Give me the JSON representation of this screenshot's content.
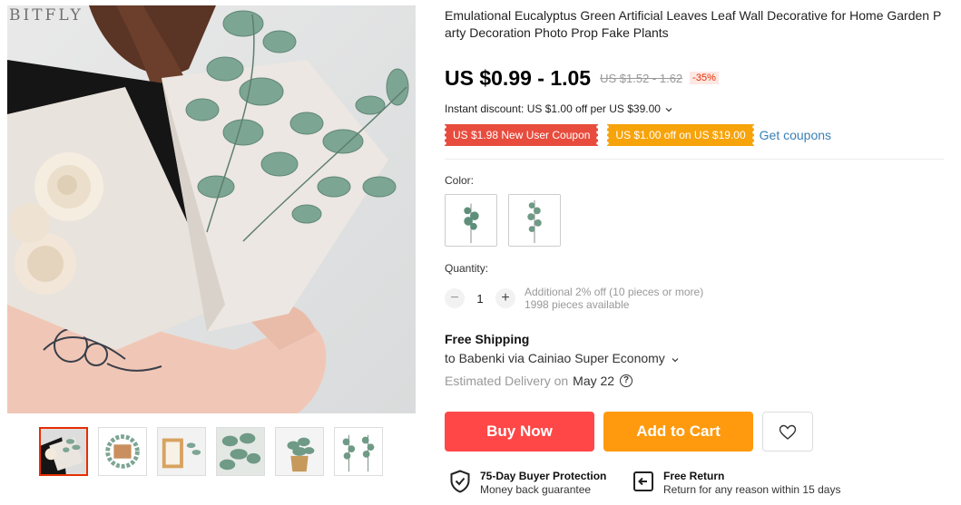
{
  "gallery": {
    "brand_watermark": "BITFLY",
    "thumbnails": [
      "eucalyptus bouquet",
      "wreath",
      "frame",
      "leaves",
      "potted",
      "branches"
    ]
  },
  "product": {
    "title": "Emulational Eucalyptus Green Artificial Leaves Leaf Wall Decorative for Home Garden Party Decoration Photo Prop Fake Plants",
    "price": "US $0.99 - 1.05",
    "original_price": "US $1.52 - 1.62",
    "discount": "-35%"
  },
  "promotions": {
    "instant_discount": "Instant discount: US $1.00 off per US $39.00",
    "coupon_new_user": "US $1.98 New User Coupon",
    "coupon_store": "US $1.00 off on US $19.00",
    "get_coupons": "Get coupons"
  },
  "sku": {
    "color_label": "Color:",
    "quantity_label": "Quantity:",
    "quantity_value": "1",
    "quantity_minus": "−",
    "quantity_plus": "+",
    "bulk_note": "Additional 2% off (10 pieces or more)",
    "available": "1998 pieces available"
  },
  "shipping": {
    "title": "Free Shipping",
    "route": "to Babenki via Cainiao Super Economy",
    "estimated_label": "Estimated Delivery on",
    "estimated_date": "May 22",
    "help": "?"
  },
  "actions": {
    "buy_now": "Buy Now",
    "add_to_cart": "Add to Cart"
  },
  "guarantees": [
    {
      "title": "75-Day Buyer Protection",
      "subtitle": "Money back guarantee"
    },
    {
      "title": "Free Return",
      "subtitle": "Return for any reason within 15 days"
    }
  ],
  "colors": {
    "price_red": "#ff4747",
    "cart_orange": "#ff9a0e",
    "coupon_red": "#e84c3d",
    "coupon_orange": "#f7a30a",
    "link_blue": "#3a7fb5",
    "leaf_green": "#6f9a86"
  }
}
